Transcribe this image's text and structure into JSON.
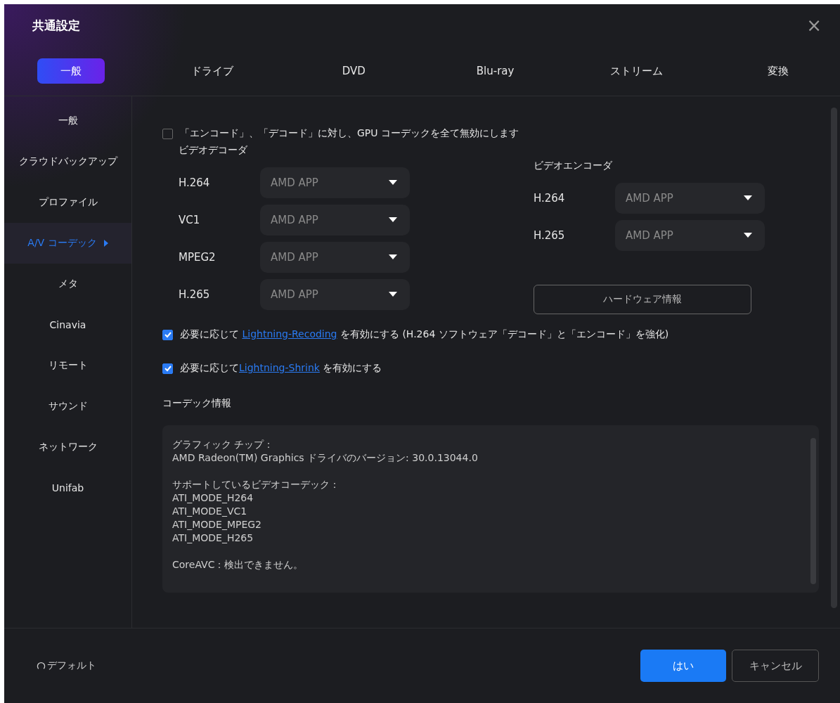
{
  "window": {
    "title": "共通設定",
    "close": "×"
  },
  "tabs": [
    {
      "label": "一般",
      "selected": true
    },
    {
      "label": "ドライブ",
      "selected": false
    },
    {
      "label": "DVD",
      "selected": false
    },
    {
      "label": "Blu-ray",
      "selected": false
    },
    {
      "label": "ストリーム",
      "selected": false
    },
    {
      "label": "変換",
      "selected": false
    }
  ],
  "sidebar": {
    "items": [
      {
        "label": "一般",
        "selected": false
      },
      {
        "label": "クラウドバックアップ",
        "selected": false
      },
      {
        "label": "プロファイル",
        "selected": false
      },
      {
        "label": "A/V コーデック",
        "selected": true
      },
      {
        "label": "メタ",
        "selected": false
      },
      {
        "label": "Cinavia",
        "selected": false
      },
      {
        "label": "リモート",
        "selected": false
      },
      {
        "label": "サウンド",
        "selected": false
      },
      {
        "label": "ネットワーク",
        "selected": false
      },
      {
        "label": "Unifab",
        "selected": false
      }
    ]
  },
  "gpu_disable": {
    "label": "「エンコード」、「デコード」に対し、GPU コーデックを全て無効にします",
    "checked": false
  },
  "decoder": {
    "title": "ビデオデコーダ",
    "rows": [
      {
        "codec": "H.264",
        "value": "AMD APP"
      },
      {
        "codec": "VC1",
        "value": "AMD APP"
      },
      {
        "codec": "MPEG2",
        "value": "AMD APP"
      },
      {
        "codec": "H.265",
        "value": "AMD APP"
      }
    ]
  },
  "encoder": {
    "title": "ビデオエンコーダ",
    "rows": [
      {
        "codec": "H.264",
        "value": "AMD APP"
      },
      {
        "codec": "H.265",
        "value": "AMD APP"
      }
    ]
  },
  "hardware_button": "ハードウェア情報",
  "options": [
    {
      "checked": true,
      "before": "必要に応じて ",
      "link": "Lightning-Recoding",
      "after": " を有効にする (H.264 ソフトウェア「デコード」と「エンコード」を強化)"
    },
    {
      "checked": true,
      "before": "必要に応じて",
      "link": "Lightning-Shrink",
      "after": " を有効にする"
    }
  ],
  "codec_info": {
    "title": "コーデック情報",
    "paragraphs": [
      [
        "グラフィック チップ：",
        "AMD Radeon(TM) Graphics ドライバのバージョン: 30.0.13044.0"
      ],
      [
        "サポートしているビデオコーデック：",
        "ATI_MODE_H264",
        "ATI_MODE_VC1",
        "ATI_MODE_MPEG2",
        "ATI_MODE_H265"
      ],
      [
        "CoreAVC：検出できません。"
      ]
    ]
  },
  "footer": {
    "default": "デフォルト",
    "ok": "はい",
    "cancel": "キャンセル"
  }
}
